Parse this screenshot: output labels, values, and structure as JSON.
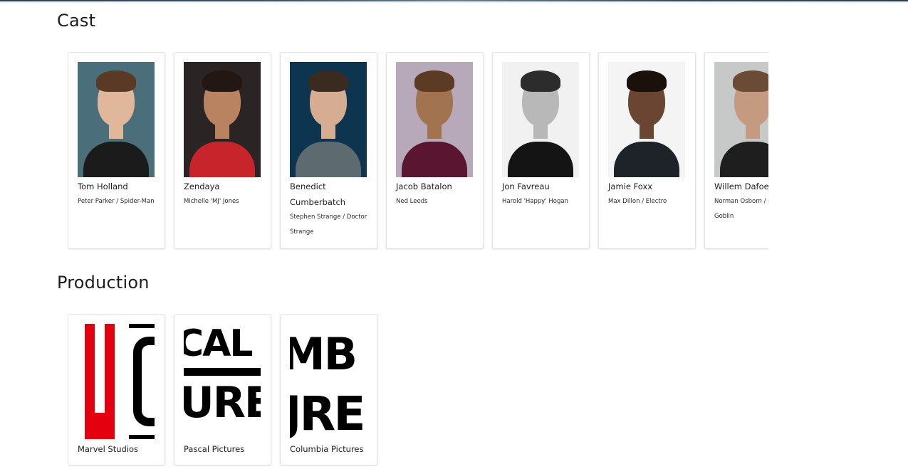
{
  "sections": {
    "cast_title": "Cast",
    "production_title": "Production"
  },
  "cast": [
    {
      "name": "Tom Holland",
      "role": "Peter Parker / Spider-Man",
      "bg": "#4a6f7a",
      "skin": "#e0b79b",
      "hair": "#5b3a25",
      "clothes": "#1b1b1b"
    },
    {
      "name": "Zendaya",
      "role": "Michelle 'MJ' Jones",
      "bg": "#2a2424",
      "skin": "#b98362",
      "hair": "#231713",
      "clothes": "#c8242b"
    },
    {
      "name": "Benedict Cumberbatch",
      "role": "Stephen Strange / Doctor Strange",
      "bg": "#0e3550",
      "skin": "#d6ad92",
      "hair": "#3a2a20",
      "clothes": "#5d6a6f"
    },
    {
      "name": "Jacob Batalon",
      "role": "Ned Leeds",
      "bg": "#b7a8ba",
      "skin": "#a1734f",
      "hair": "#5c3b24",
      "clothes": "#5a1630"
    },
    {
      "name": "Jon Favreau",
      "role": "Harold 'Happy' Hogan",
      "bg": "#f1f1f1",
      "skin": "#b8b8b8",
      "hair": "#2c2c2c",
      "clothes": "#141414"
    },
    {
      "name": "Jamie Foxx",
      "role": "Max Dillon / Electro",
      "bg": "#f4f4f4",
      "skin": "#6a4532",
      "hair": "#1a110c",
      "clothes": "#1e2229"
    },
    {
      "name": "Willem Dafoe",
      "role": "Norman Osborn / Green Goblin",
      "bg": "#c6c9c8",
      "skin": "#c49a80",
      "hair": "#6a4b35",
      "clothes": "#1e1e1e"
    }
  ],
  "production": [
    {
      "name": "Marvel Studios",
      "logo_text": "L S"
    },
    {
      "name": "Pascal Pictures",
      "logo_text": "CAL URE"
    },
    {
      "name": "Columbia Pictures",
      "logo_text": "MB JRE"
    }
  ]
}
